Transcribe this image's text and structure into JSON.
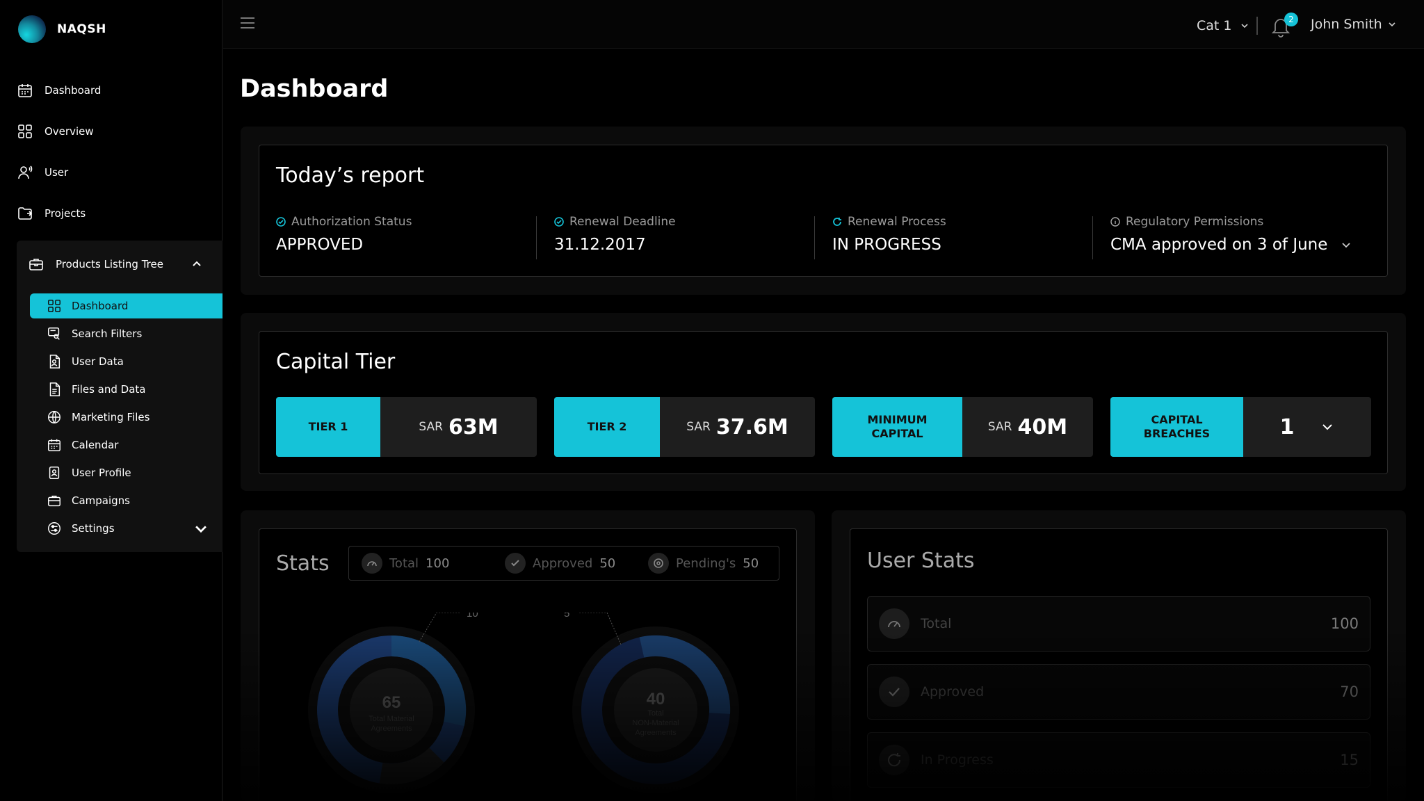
{
  "app": {
    "brand": "NAQSH"
  },
  "sidebar": {
    "items": [
      {
        "label": "Dashboard",
        "icon": "calendar-icon"
      },
      {
        "label": "Overview",
        "icon": "grid-icon"
      },
      {
        "label": "User",
        "icon": "user-icon"
      },
      {
        "label": "Projects",
        "icon": "folder-icon"
      }
    ],
    "tree": {
      "label": "Products Listing Tree",
      "items": [
        {
          "label": "Dashboard",
          "icon": "grid-icon",
          "active": true
        },
        {
          "label": "Search Filters",
          "icon": "search-filter-icon"
        },
        {
          "label": "User Data",
          "icon": "file-user-icon"
        },
        {
          "label": "Files and Data",
          "icon": "file-icon"
        },
        {
          "label": "Marketing Files",
          "icon": "globe-icon"
        },
        {
          "label": "Calendar",
          "icon": "calendar-icon"
        },
        {
          "label": "User Profile",
          "icon": "profile-icon"
        },
        {
          "label": "Campaigns",
          "icon": "briefcase-icon"
        },
        {
          "label": "Settings",
          "icon": "settings-icon"
        }
      ]
    }
  },
  "topbar": {
    "category": "Cat 1",
    "notifications": "2",
    "user": "John Smith"
  },
  "page": {
    "title": "Dashboard"
  },
  "report": {
    "title": "Today’s report",
    "items": [
      {
        "label": "Authorization Status",
        "value": "APPROVED",
        "icon": "check-circle-icon"
      },
      {
        "label": "Renewal Deadline",
        "value": "31.12.2017",
        "icon": "check-circle-icon"
      },
      {
        "label": "Renewal Process",
        "value": "IN PROGRESS",
        "icon": "refresh-icon"
      },
      {
        "label": "Regulatory Permissions",
        "value": "CMA approved on 3 of June",
        "icon": "info-icon"
      }
    ]
  },
  "capital": {
    "title": "Capital Tier",
    "tiers": [
      {
        "label": "TIER 1",
        "currency": "SAR",
        "value": "63M"
      },
      {
        "label": "TIER 2",
        "currency": "SAR",
        "value": "37.6M"
      },
      {
        "label": "MINIMUM CAPITAL",
        "currency": "SAR",
        "value": "40M"
      },
      {
        "label": "CAPITAL BREACHES",
        "currency": "",
        "value": "1"
      }
    ]
  },
  "stats": {
    "title": "Stats",
    "bar": [
      {
        "label": "Total",
        "value": "100"
      },
      {
        "label": "Approved",
        "value": "50"
      },
      {
        "label": "Pending's",
        "value": "50"
      }
    ],
    "donuts": [
      {
        "value": "65",
        "label": "Total Material Agreements",
        "callout": "10"
      },
      {
        "value": "40",
        "label": "Total NON-Material Agreements",
        "callout": "5"
      }
    ]
  },
  "user_stats": {
    "title": "User Stats",
    "rows": [
      {
        "label": "Total",
        "value": "100"
      },
      {
        "label": "Approved",
        "value": "70"
      },
      {
        "label": "In Progress",
        "value": "15"
      }
    ]
  },
  "colors": {
    "accent": "#15c3d8",
    "background": "#000000",
    "panel": "#0b0b0b"
  }
}
